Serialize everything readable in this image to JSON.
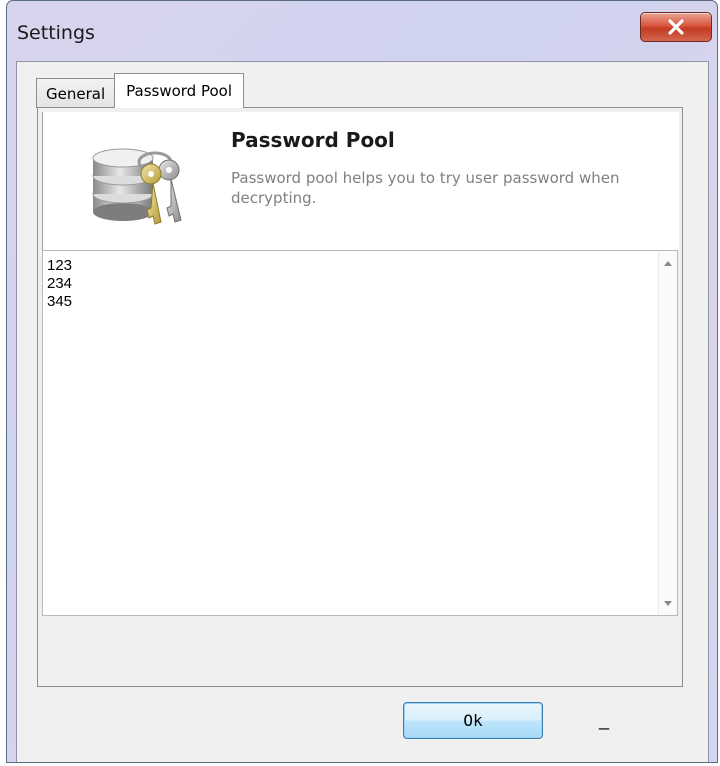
{
  "window": {
    "title": "Settings",
    "close_glyph": "X"
  },
  "tabs": [
    {
      "label": "General",
      "active": false
    },
    {
      "label": "Password Pool",
      "active": true
    }
  ],
  "header": {
    "icon": "keys-database-icon",
    "title": "Password Pool",
    "description": "Password pool helps you to try user password when decrypting."
  },
  "pool": {
    "entries": [
      "123",
      "234",
      "345"
    ]
  },
  "footer": {
    "ok_label": "Ok",
    "minimize_glyph": "_"
  },
  "colors": {
    "close_button": "#c8412a",
    "ok_button_border": "#3c7fb1",
    "description_text": "#808080"
  }
}
